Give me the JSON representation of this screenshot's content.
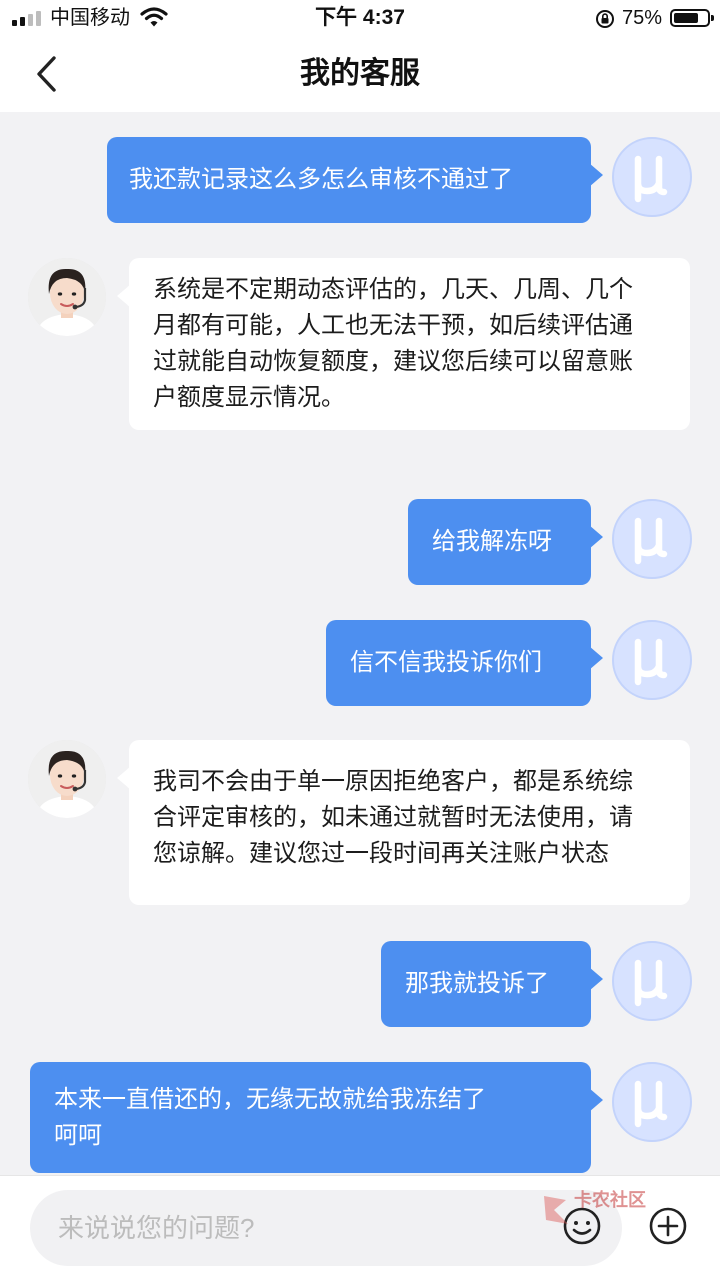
{
  "status_bar": {
    "carrier": "中国移动",
    "time": "下午 4:37",
    "battery_percent": "75%",
    "battery_level": 0.75,
    "signal_bars_active": 2,
    "icons": [
      "signal-icon",
      "wifi-icon",
      "orientation-lock-icon",
      "battery-icon"
    ]
  },
  "header": {
    "title": "我的客服",
    "back_icon": "chevron-left-icon"
  },
  "messages": [
    {
      "from": "user",
      "lines": [
        "我还款记录这么多怎么审核不通过了"
      ]
    },
    {
      "from": "agent",
      "lines": [
        "系统是不定期动态评估的，几天、几周、几个",
        "月都有可能，人工也无法干预，如后续评估通",
        "过就能自动恢复额度，建议您后续可以留意账",
        "户额度显示情况。"
      ]
    },
    {
      "from": "user",
      "lines": [
        "给我解冻呀"
      ]
    },
    {
      "from": "user",
      "lines": [
        "信不信我投诉你们"
      ]
    },
    {
      "from": "agent",
      "lines": [
        "我司不会由于单一原因拒绝客户，都是系统综",
        "合评定审核的，如未通过就暂时无法使用，请",
        "您谅解。建议您过一段时间再关注账户状态"
      ]
    },
    {
      "from": "user",
      "lines": [
        "那我就投诉了"
      ]
    },
    {
      "from": "user",
      "lines": [
        "本来一直借还的，无缘无故就给我冻结了",
        "呵呵"
      ]
    }
  ],
  "input": {
    "placeholder": "来说说您的问题?",
    "value": ""
  },
  "watermark": {
    "text": "卡农社区"
  },
  "colors": {
    "accent": "#4d8ff0",
    "background": "#f2f2f4",
    "user_avatar": "#d7e2ff"
  }
}
